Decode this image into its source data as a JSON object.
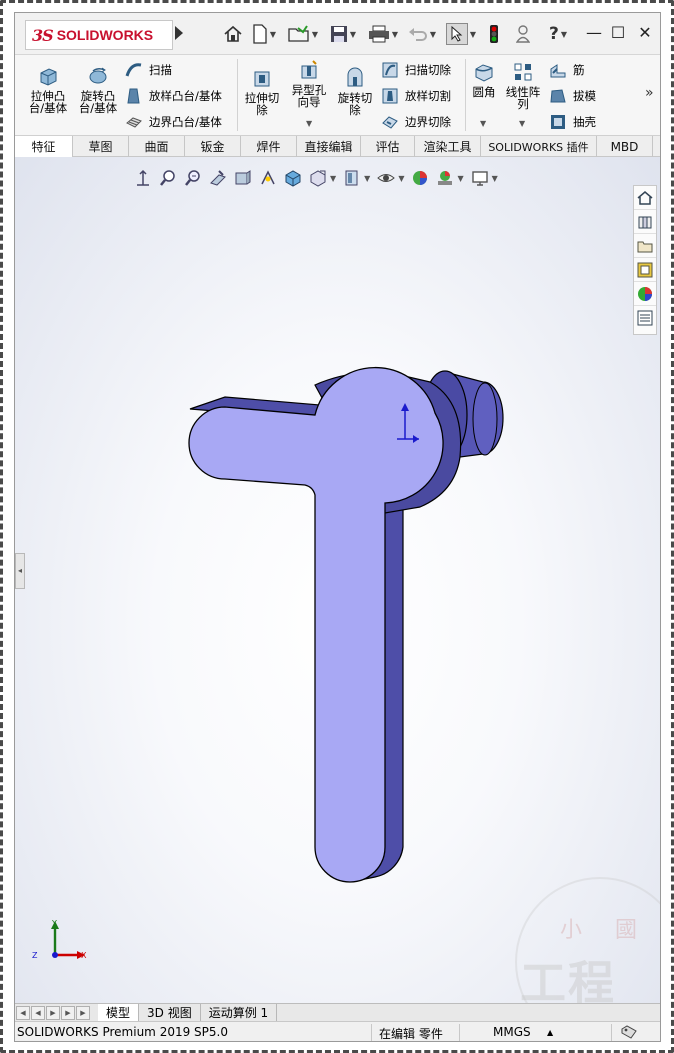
{
  "app": {
    "logo_prefix": "3S",
    "logo_text": "SOLIDWORKS"
  },
  "colors": {
    "brand": "#c8102e",
    "part_face": "#a8a8f4",
    "part_side": "#4e4ea8",
    "part_dark": "#3b3b8c",
    "triad_x": "#cc0000",
    "triad_y": "#1a7a1a",
    "triad_z": "#1a1acc"
  },
  "quick_access": {
    "icons": [
      "home-icon",
      "new-document-icon",
      "open-folder-icon",
      "save-icon",
      "print-icon",
      "undo-icon",
      "select-icon",
      "rebuild-icon",
      "options-icon",
      "help-icon"
    ],
    "help_label": "?"
  },
  "window_controls": {
    "minimize": "—",
    "maximize": "☐",
    "close": "✕"
  },
  "ribbon": {
    "extrude_boss": "拉伸凸台/基体",
    "revolve_boss": "旋转凸台/基体",
    "sweep": "扫描",
    "loft_boss": "放样凸台/基体",
    "boundary_boss": "边界凸台/基体",
    "extrude_cut": "拉伸切除",
    "hole_wizard": "异型孔向导",
    "revolve_cut": "旋转切除",
    "swept_cut": "扫描切除",
    "lofted_cut": "放样切割",
    "boundary_cut": "边界切除",
    "fillet": "圆角",
    "linear_pattern": "线性阵列",
    "rib": "筋",
    "draft": "拔模",
    "shell": "抽壳",
    "more": "»"
  },
  "tabs": [
    {
      "label": "特征",
      "active": true
    },
    {
      "label": "草图",
      "active": false
    },
    {
      "label": "曲面",
      "active": false
    },
    {
      "label": "钣金",
      "active": false
    },
    {
      "label": "焊件",
      "active": false
    },
    {
      "label": "直接编辑",
      "active": false
    },
    {
      "label": "评估",
      "active": false
    },
    {
      "label": "渲染工具",
      "active": false
    },
    {
      "label": "SOLIDWORKS 插件",
      "active": false
    },
    {
      "label": "MBD",
      "active": false
    }
  ],
  "heads_up_icons": [
    "zoom-to-fit-icon",
    "zoom-area-icon",
    "previous-view-icon",
    "section-view-icon",
    "dynamic-annotation-icon",
    "view-orientation-icon",
    "display-style-icon",
    "hide-show-icon",
    "edit-appearance-icon",
    "apply-scene-icon",
    "view-settings-icon"
  ],
  "task_pane_icons": [
    "solidworks-resources-icon",
    "design-library-icon",
    "file-explorer-icon",
    "view-palette-icon",
    "appearances-icon",
    "custom-properties-icon"
  ],
  "triad": {
    "x": "X",
    "y": "Y",
    "z": "Z"
  },
  "watermark": {
    "line": "工程师",
    "seal_left": "小",
    "seal_right": "國"
  },
  "bottom_tabs": [
    {
      "label": "模型",
      "active": true
    },
    {
      "label": "3D 视图",
      "active": false
    },
    {
      "label": "运动算例 1",
      "active": false
    }
  ],
  "status": {
    "product": "SOLIDWORKS Premium 2019 SP5.0",
    "editing": "在编辑 零件",
    "units": "MMGS",
    "units_arrow": "▲"
  }
}
